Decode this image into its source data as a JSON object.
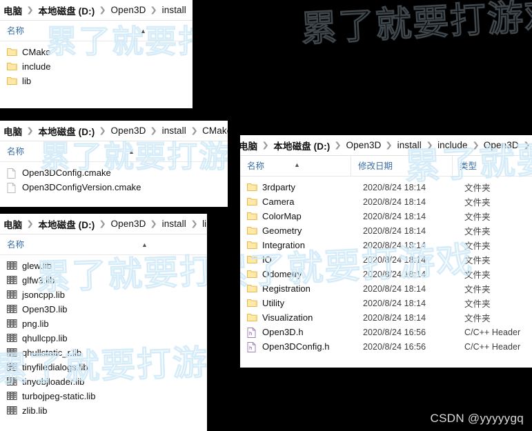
{
  "watermark": {
    "text": "累了就要打游戏",
    "color": "#cfe9f7",
    "csdn": "CSDN @yyyyygq",
    "csdn_color": "#d9d9d9"
  },
  "icons": {
    "folder": "folder-icon",
    "header_file": "h-file-icon",
    "lib_file": "lib-file-icon",
    "sort_caret": "sort-ascending-caret-icon",
    "breadcrumb_sep": "chevron-right-icon"
  },
  "colors": {
    "folder_fill": "#fde9a9",
    "folder_edge": "#e8b84b",
    "column_header_text": "#3a6ea5",
    "background": "#000000",
    "panel": "#ffffff"
  },
  "panels": [
    {
      "id": "install",
      "breadcrumb": [
        "电脑",
        "本地磁盘 (D:)",
        "Open3D",
        "install"
      ],
      "columns": [
        "名称"
      ],
      "items": [
        {
          "name": "CMake",
          "icon": "folder-icon"
        },
        {
          "name": "include",
          "icon": "folder-icon"
        },
        {
          "name": "lib",
          "icon": "folder-icon"
        }
      ]
    },
    {
      "id": "cmake",
      "breadcrumb": [
        "电脑",
        "本地磁盘 (D:)",
        "Open3D",
        "install",
        "CMake"
      ],
      "columns": [
        "名称"
      ],
      "items": [
        {
          "name": "Open3DConfig.cmake",
          "icon": "generic-file-icon"
        },
        {
          "name": "Open3DConfigVersion.cmake",
          "icon": "generic-file-icon"
        }
      ]
    },
    {
      "id": "lib",
      "breadcrumb": [
        "电脑",
        "本地磁盘 (D:)",
        "Open3D",
        "install",
        "lib"
      ],
      "columns": [
        "名称"
      ],
      "items": [
        {
          "name": "glew.lib",
          "icon": "lib-file-icon"
        },
        {
          "name": "glfw3.lib",
          "icon": "lib-file-icon"
        },
        {
          "name": "jsoncpp.lib",
          "icon": "lib-file-icon"
        },
        {
          "name": "Open3D.lib",
          "icon": "lib-file-icon"
        },
        {
          "name": "png.lib",
          "icon": "lib-file-icon"
        },
        {
          "name": "qhullcpp.lib",
          "icon": "lib-file-icon"
        },
        {
          "name": "qhullstatic_r.lib",
          "icon": "lib-file-icon"
        },
        {
          "name": "tinyfiledialogs.lib",
          "icon": "lib-file-icon"
        },
        {
          "name": "tinyobjloader.lib",
          "icon": "lib-file-icon"
        },
        {
          "name": "turbojpeg-static.lib",
          "icon": "lib-file-icon"
        },
        {
          "name": "zlib.lib",
          "icon": "lib-file-icon"
        }
      ]
    },
    {
      "id": "include-open3d",
      "breadcrumb": [
        "电脑",
        "本地磁盘 (D:)",
        "Open3D",
        "install",
        "include",
        "Open3D"
      ],
      "breadcrumb_trailing_sep": true,
      "columns": [
        "名称",
        "修改日期",
        "类型"
      ],
      "items": [
        {
          "name": "3rdparty",
          "date": "2020/8/24 18:14",
          "type": "文件夹",
          "icon": "folder-icon"
        },
        {
          "name": "Camera",
          "date": "2020/8/24 18:14",
          "type": "文件夹",
          "icon": "folder-icon"
        },
        {
          "name": "ColorMap",
          "date": "2020/8/24 18:14",
          "type": "文件夹",
          "icon": "folder-icon"
        },
        {
          "name": "Geometry",
          "date": "2020/8/24 18:14",
          "type": "文件夹",
          "icon": "folder-icon"
        },
        {
          "name": "Integration",
          "date": "2020/8/24 18:14",
          "type": "文件夹",
          "icon": "folder-icon"
        },
        {
          "name": "IO",
          "date": "2020/8/24 18:14",
          "type": "文件夹",
          "icon": "folder-icon"
        },
        {
          "name": "Odometry",
          "date": "2020/8/24 18:14",
          "type": "文件夹",
          "icon": "folder-icon"
        },
        {
          "name": "Registration",
          "date": "2020/8/24 18:14",
          "type": "文件夹",
          "icon": "folder-icon"
        },
        {
          "name": "Utility",
          "date": "2020/8/24 18:14",
          "type": "文件夹",
          "icon": "folder-icon"
        },
        {
          "name": "Visualization",
          "date": "2020/8/24 18:14",
          "type": "文件夹",
          "icon": "folder-icon"
        },
        {
          "name": "Open3D.h",
          "date": "2020/8/24 16:56",
          "type": "C/C++ Header",
          "icon": "h-file-icon"
        },
        {
          "name": "Open3DConfig.h",
          "date": "2020/8/24 16:56",
          "type": "C/C++ Header",
          "icon": "h-file-icon"
        }
      ]
    }
  ]
}
